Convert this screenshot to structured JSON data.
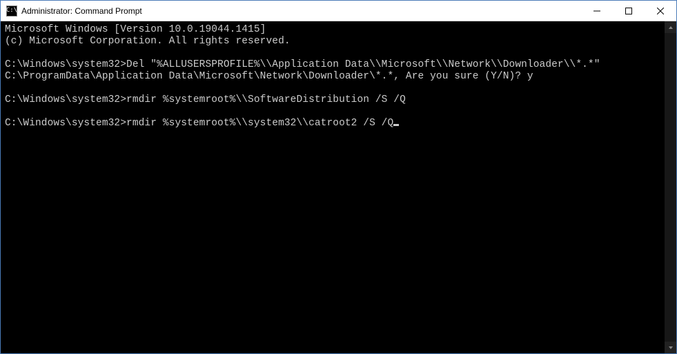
{
  "window": {
    "title": "Administrator: Command Prompt",
    "icon_text": "C:\\"
  },
  "terminal": {
    "lines": [
      "Microsoft Windows [Version 10.0.19044.1415]",
      "(c) Microsoft Corporation. All rights reserved.",
      "",
      "C:\\Windows\\system32>Del \"%ALLUSERSPROFILE%\\\\Application Data\\\\Microsoft\\\\Network\\\\Downloader\\\\*.*\"",
      "C:\\ProgramData\\Application Data\\Microsoft\\Network\\Downloader\\*.*, Are you sure (Y/N)? y",
      "",
      "C:\\Windows\\system32>rmdir %systemroot%\\\\SoftwareDistribution /S /Q",
      "",
      "C:\\Windows\\system32>rmdir %systemroot%\\\\system32\\\\catroot2 /S /Q"
    ],
    "cursor_after_last": true
  }
}
